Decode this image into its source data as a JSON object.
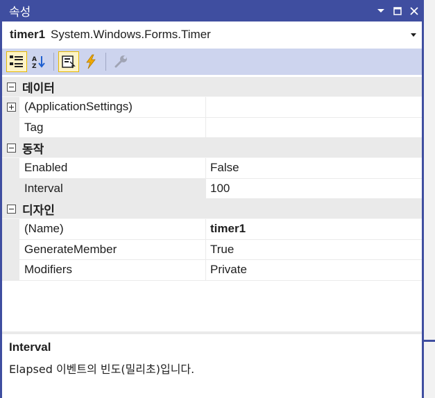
{
  "window": {
    "title": "속성",
    "controls": [
      "chevron-down-icon",
      "maximize-icon",
      "close-icon"
    ]
  },
  "object_selector": {
    "name": "timer1",
    "type": "System.Windows.Forms.Timer"
  },
  "toolbar": {
    "buttons": [
      {
        "icon": "categorized-icon",
        "active": true
      },
      {
        "icon": "alphabetical-icon",
        "active": false
      },
      {
        "icon": "properties-icon",
        "active": true
      },
      {
        "icon": "events-lightning-icon",
        "active": false
      },
      {
        "icon": "property-pages-wrench-icon",
        "active": false
      }
    ]
  },
  "grid": {
    "categories": [
      {
        "label": "데이터",
        "properties": [
          {
            "name": "(ApplicationSettings)",
            "value": "",
            "expandable": true
          },
          {
            "name": "Tag",
            "value": ""
          }
        ]
      },
      {
        "label": "동작",
        "properties": [
          {
            "name": "Enabled",
            "value": "False"
          },
          {
            "name": "Interval",
            "value": "100",
            "selected": true
          }
        ]
      },
      {
        "label": "디자인",
        "properties": [
          {
            "name": "(Name)",
            "value": "timer1",
            "bold": true
          },
          {
            "name": "GenerateMember",
            "value": "True"
          },
          {
            "name": "Modifiers",
            "value": "Private"
          }
        ]
      }
    ]
  },
  "description": {
    "title": "Interval",
    "text": "Elapsed 이벤트의 빈도(밀리초)입니다."
  },
  "colors": {
    "titlebar": "#3f4ea0",
    "toolbar": "#cdd4ee",
    "category": "#eaeaea",
    "active_button": "#fdf3c6"
  }
}
